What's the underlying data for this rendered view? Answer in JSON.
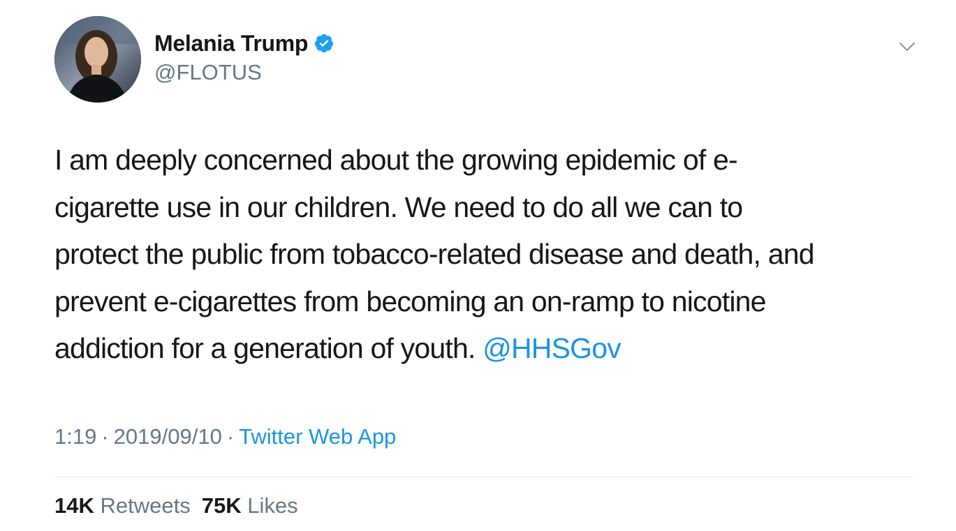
{
  "author": {
    "display_name": "Melania Trump",
    "handle": "@FLOTUS",
    "verified": true
  },
  "tweet": {
    "lines": [
      "I am deeply concerned about the growing epidemic of e-",
      "cigarette use in our children. We need to do all we can to",
      "protect the public from tobacco-related disease and death, and",
      "prevent e-cigarettes from becoming an on-ramp to nicotine",
      "addiction for a generation of youth."
    ],
    "mention": "@HHSGov"
  },
  "meta": {
    "time": "1:19",
    "separator": "·",
    "date": "2019/09/10",
    "source": "Twitter Web App"
  },
  "stats": {
    "retweets_count": "14K",
    "retweets_label": "Retweets",
    "likes_count": "75K",
    "likes_label": "Likes"
  },
  "colors": {
    "link": "#1b95e0",
    "text": "#14171a",
    "secondary": "#657786",
    "divider": "#e1e8ed"
  }
}
